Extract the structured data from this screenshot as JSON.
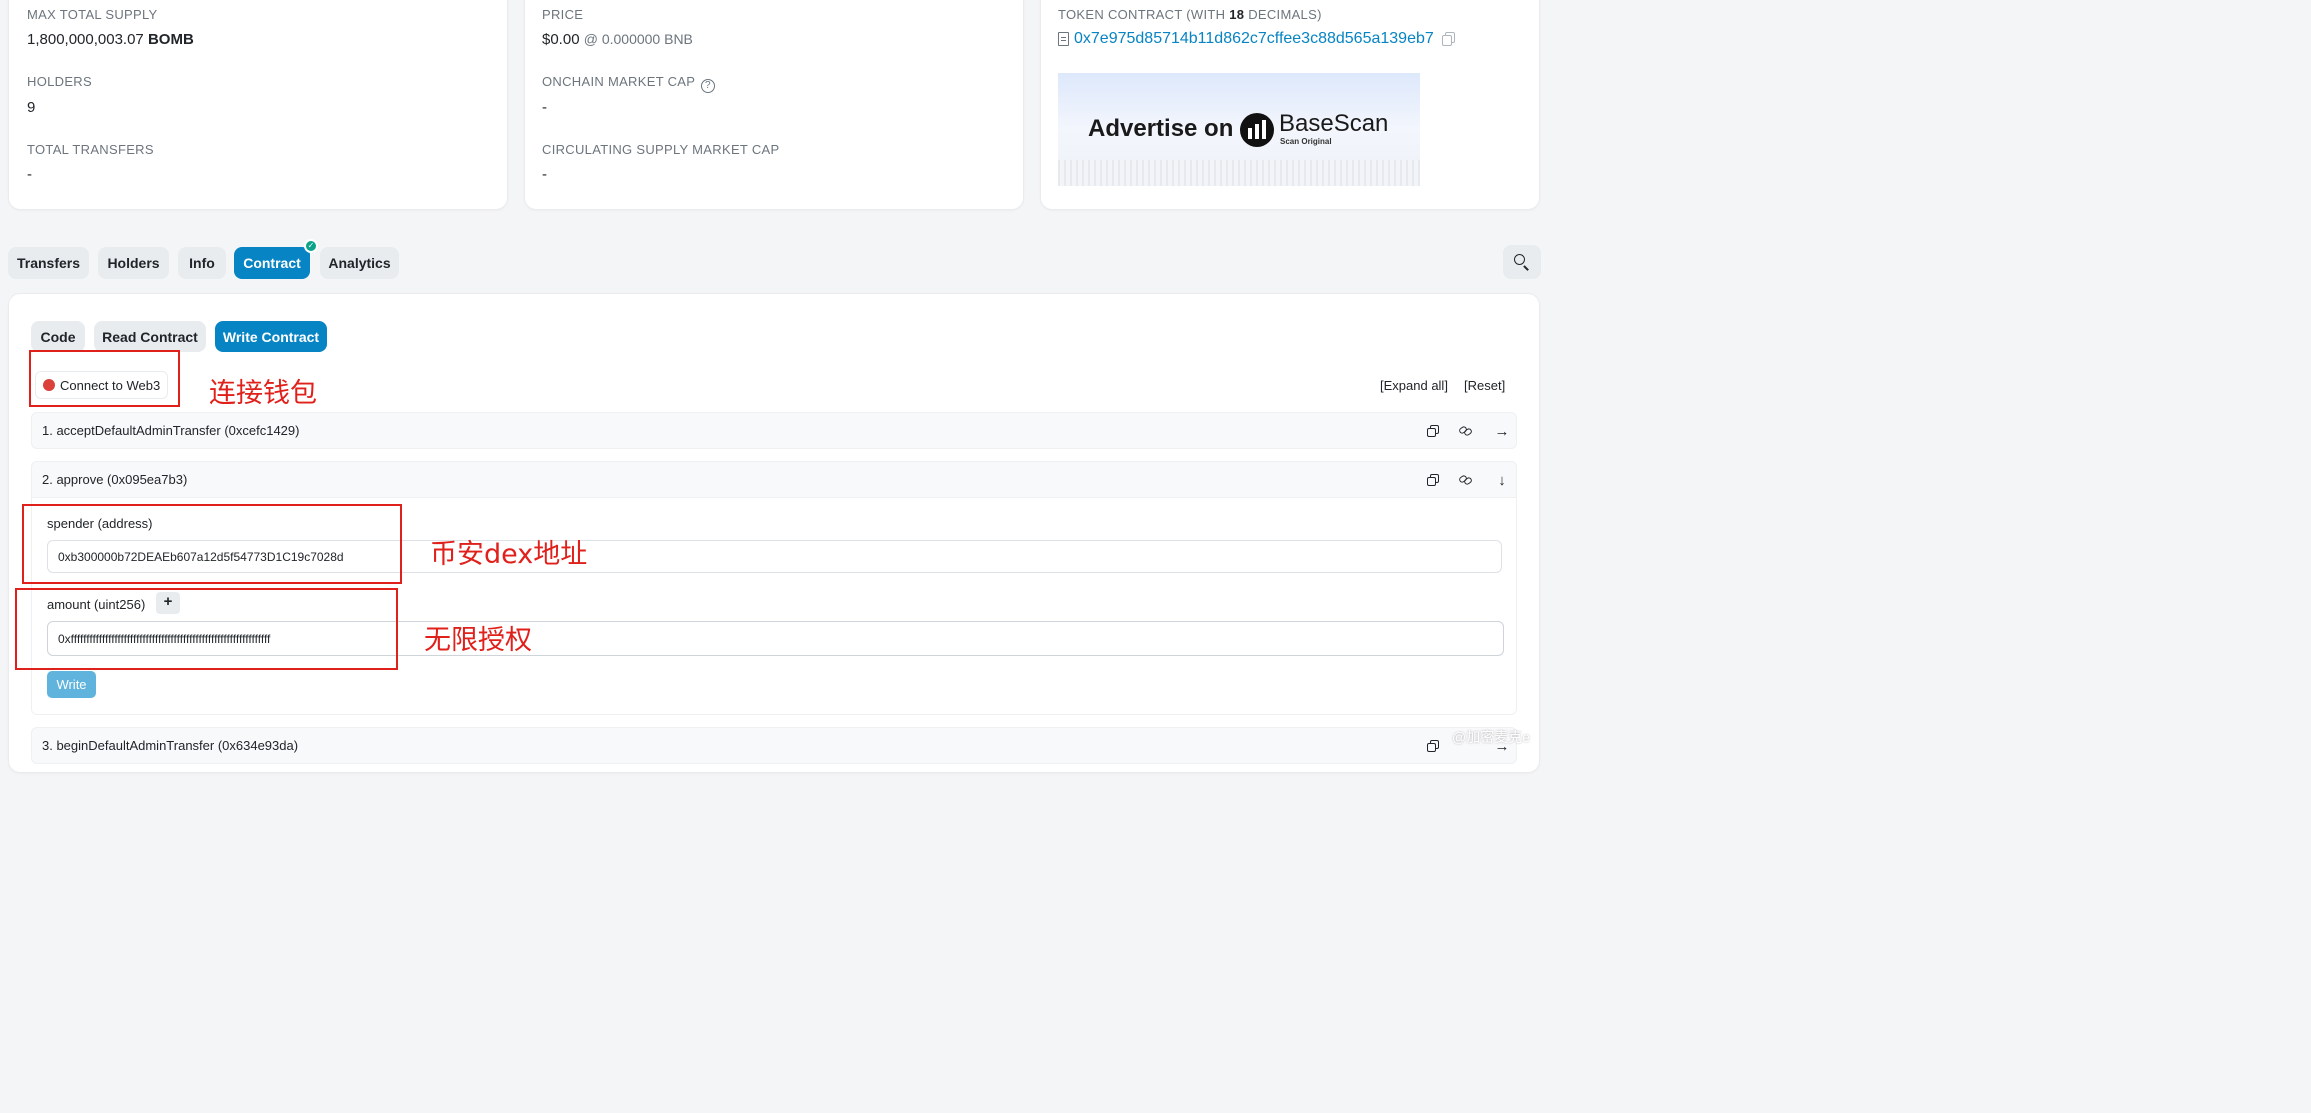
{
  "overview": {
    "max_supply_label": "MAX TOTAL SUPPLY",
    "max_supply_value": "1,800,000,003.07",
    "max_supply_symbol": "BOMB",
    "holders_label": "HOLDERS",
    "holders_value": "9",
    "transfers_label": "TOTAL TRANSFERS",
    "transfers_value": "-"
  },
  "market": {
    "price_label": "PRICE",
    "price_value": "$0.00",
    "price_bnb": "@ 0.000000 BNB",
    "onchain_cap_label": "ONCHAIN MARKET CAP",
    "onchain_cap_value": "-",
    "circ_cap_label": "CIRCULATING SUPPLY MARKET CAP",
    "circ_cap_value": "-"
  },
  "contract_info": {
    "label_prefix": "TOKEN CONTRACT (WITH",
    "label_decimals": "18",
    "label_suffix": "DECIMALS)",
    "address": "0x7e975d85714b11d862c7cffee3c88d565a139eb7",
    "ad_text": "Advertise on",
    "ad_brand": "BaseScan",
    "ad_tagline": "Scan Original"
  },
  "tabs": [
    "Transfers",
    "Holders",
    "Info",
    "Contract",
    "Analytics"
  ],
  "active_tab": "Contract",
  "subtabs": [
    "Code",
    "Read Contract",
    "Write Contract"
  ],
  "active_subtab": "Write Contract",
  "connect_label": "Connect to Web3",
  "expand_all": "[Expand all]",
  "reset": "[Reset]",
  "functions": [
    {
      "title": "1. acceptDefaultAdminTransfer (0xcefc1429)"
    },
    {
      "title": "2. approve (0x095ea7b3)"
    },
    {
      "title": "3. beginDefaultAdminTransfer (0x634e93da)"
    }
  ],
  "approve_form": {
    "spender_label": "spender (address)",
    "spender_value": "0xb300000b72DEAEb607a12d5f54773D1C19c7028d",
    "amount_label": "amount (uint256)",
    "amount_plus": "+",
    "amount_value": "0xffffffffffffffffffffffffffffffffffffffffffffffffffffffffffffffff",
    "write_label": "Write"
  },
  "annotations": {
    "connect_wallet": "连接钱包",
    "dex_address": "币安dex地址",
    "unlimited_approval": "无限授权"
  },
  "watermark": "@加密麦克e",
  "colors": {
    "accent": "#0784c3",
    "annotation": "#e0201b",
    "connect_dot": "#d9413a",
    "write_button": "#5fb3dc"
  }
}
